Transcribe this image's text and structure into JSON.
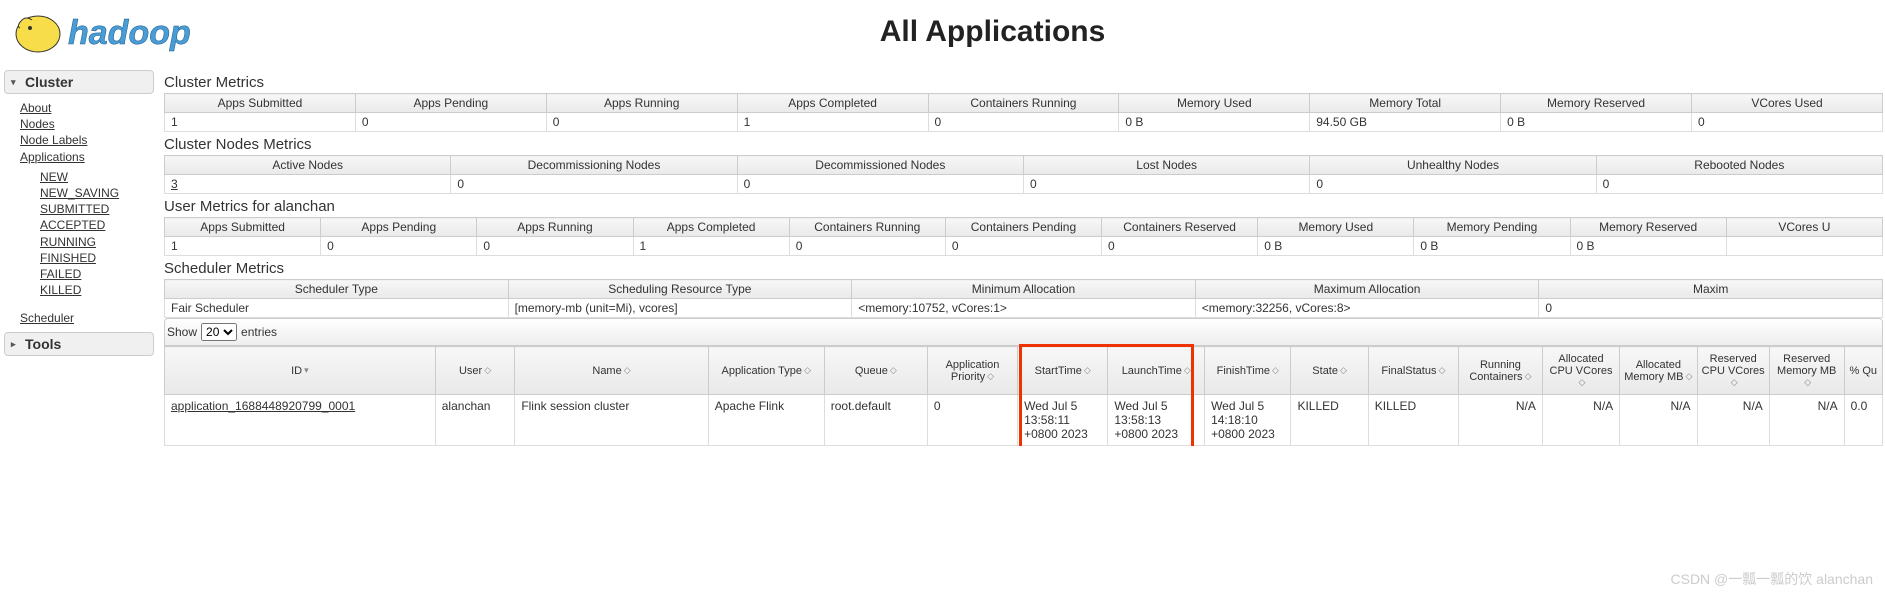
{
  "title": "All Applications",
  "sidebar": {
    "cluster_label": "Cluster",
    "tools_label": "Tools",
    "links": {
      "about": "About",
      "nodes": "Nodes",
      "node_labels": "Node Labels",
      "applications": "Applications",
      "new": "NEW",
      "new_saving": "NEW_SAVING",
      "submitted": "SUBMITTED",
      "accepted": "ACCEPTED",
      "running": "RUNNING",
      "finished": "FINISHED",
      "failed": "FAILED",
      "killed": "KILLED",
      "scheduler": "Scheduler"
    }
  },
  "sections": {
    "cluster_metrics": "Cluster Metrics",
    "cluster_nodes_metrics": "Cluster Nodes Metrics",
    "user_metrics": "User Metrics for alanchan",
    "scheduler_metrics": "Scheduler Metrics"
  },
  "cluster_metrics": {
    "headers": [
      "Apps Submitted",
      "Apps Pending",
      "Apps Running",
      "Apps Completed",
      "Containers Running",
      "Memory Used",
      "Memory Total",
      "Memory Reserved",
      "VCores Used"
    ],
    "values": [
      "1",
      "0",
      "0",
      "1",
      "0",
      "0 B",
      "94.50 GB",
      "0 B",
      "0"
    ]
  },
  "nodes_metrics": {
    "headers": [
      "Active Nodes",
      "Decommissioning Nodes",
      "Decommissioned Nodes",
      "Lost Nodes",
      "Unhealthy Nodes",
      "Rebooted Nodes"
    ],
    "values": [
      "3",
      "0",
      "0",
      "0",
      "0",
      "0"
    ]
  },
  "user_metrics": {
    "headers": [
      "Apps Submitted",
      "Apps Pending",
      "Apps Running",
      "Apps Completed",
      "Containers Running",
      "Containers Pending",
      "Containers Reserved",
      "Memory Used",
      "Memory Pending",
      "Memory Reserved",
      "VCores U"
    ],
    "values": [
      "1",
      "0",
      "0",
      "1",
      "0",
      "0",
      "0",
      "0 B",
      "0 B",
      "0 B",
      ""
    ]
  },
  "scheduler_metrics": {
    "headers": [
      "Scheduler Type",
      "Scheduling Resource Type",
      "Minimum Allocation",
      "Maximum Allocation",
      "Maxim"
    ],
    "values": [
      "Fair Scheduler",
      "[memory-mb (unit=Mi), vcores]",
      "<memory:10752, vCores:1>",
      "<memory:32256, vCores:8>",
      "0"
    ]
  },
  "show_label_pre": "Show",
  "show_value": "20",
  "show_label_post": "entries",
  "app_headers": {
    "id": "ID",
    "user": "User",
    "name": "Name",
    "apptype": "Application Type",
    "queue": "Queue",
    "priority": "Application Priority",
    "starttime": "StartTime",
    "launchtime": "LaunchTime",
    "finishtime": "FinishTime",
    "state": "State",
    "finalstatus": "FinalStatus",
    "runcont": "Running Containers",
    "alloccpu": "Allocated CPU VCores",
    "allocmem": "Allocated Memory MB",
    "rescpu": "Reserved CPU VCores",
    "resmem": "Reserved Memory MB",
    "pctqu": "% Qu"
  },
  "app_row": {
    "id": "application_1688448920799_0001",
    "user": "alanchan",
    "name": "Flink session cluster",
    "apptype": "Apache Flink",
    "queue": "root.default",
    "priority": "0",
    "starttime": "Wed Jul 5 13:58:11 +0800 2023",
    "launchtime": "Wed Jul 5 13:58:13 +0800 2023",
    "finishtime": "Wed Jul 5 14:18:10 +0800 2023",
    "state": "KILLED",
    "finalstatus": "KILLED",
    "runcont": "N/A",
    "alloccpu": "N/A",
    "allocmem": "N/A",
    "rescpu": "N/A",
    "resmem": "N/A",
    "pctqu": "0.0"
  },
  "watermark": "CSDN @一瓢一瓢的饮 alanchan"
}
